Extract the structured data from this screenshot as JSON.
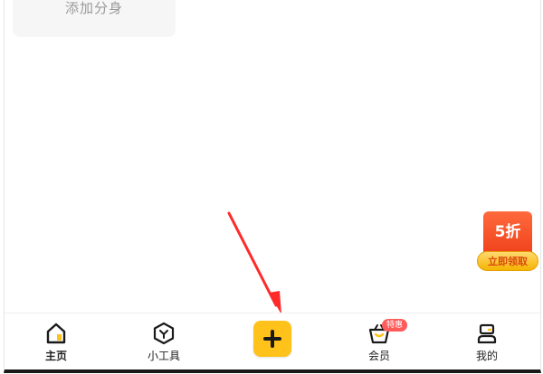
{
  "top_card": {
    "label": "添加分身"
  },
  "promo": {
    "badge": "5折",
    "claim": "立即领取",
    "colors": {
      "badge_red": "#f0431d",
      "claim_gold": "#ffc21a"
    }
  },
  "annotation": {
    "color": "#ff2a2a",
    "icon": "red-arrow-pointer"
  },
  "tabbar": {
    "tabs": [
      {
        "label": "主页",
        "icon": "home-icon",
        "active": true
      },
      {
        "label": "小工具",
        "icon": "hexagon-tool-icon",
        "active": false
      },
      {
        "label": "会员",
        "icon": "basket-vip-icon",
        "active": false,
        "badge": "特惠"
      },
      {
        "label": "我的",
        "icon": "person-icon",
        "active": false
      }
    ],
    "center_button": {
      "icon": "plus-icon",
      "color": "#ffc21a"
    }
  }
}
